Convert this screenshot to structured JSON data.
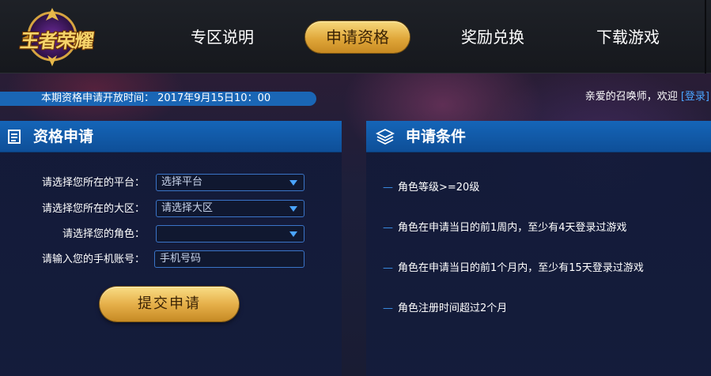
{
  "header": {
    "logo_text": "王者荣耀",
    "nav": [
      {
        "label": "专区说明"
      },
      {
        "label": "申请资格"
      },
      {
        "label": "奖励兑换"
      },
      {
        "label": "下载游戏"
      }
    ],
    "active_nav": "申请资格"
  },
  "notice": {
    "text": "本期资格申请开放时间：  2017年9月15日10：00"
  },
  "welcome": {
    "text": "亲爱的召唤师，欢迎",
    "login_link": "[登录]"
  },
  "apply_panel": {
    "title": "资格申请",
    "fields": [
      {
        "label": "请选择您所在的平台：",
        "value": "选择平台"
      },
      {
        "label": "请选择您所在的大区：",
        "value": "请选择大区"
      },
      {
        "label": "请选择您的角色：",
        "value": ""
      },
      {
        "label": "请输入您的手机账号：",
        "placeholder": "手机号码"
      }
    ],
    "submit_label": "提交申请"
  },
  "conditions_panel": {
    "title": "申请条件",
    "items": [
      "角色等级>=20级",
      "角色在申请当日的前1周内，至少有4天登录过游戏",
      "角色在申请当日的前1个月内，至少有15天登录过游戏",
      "角色注册时间超过2个月"
    ],
    "bullet": "—"
  },
  "colors": {
    "accent_blue": "#1a66b5",
    "gold": "#e0a73a",
    "link_blue": "#4aa4ff"
  }
}
